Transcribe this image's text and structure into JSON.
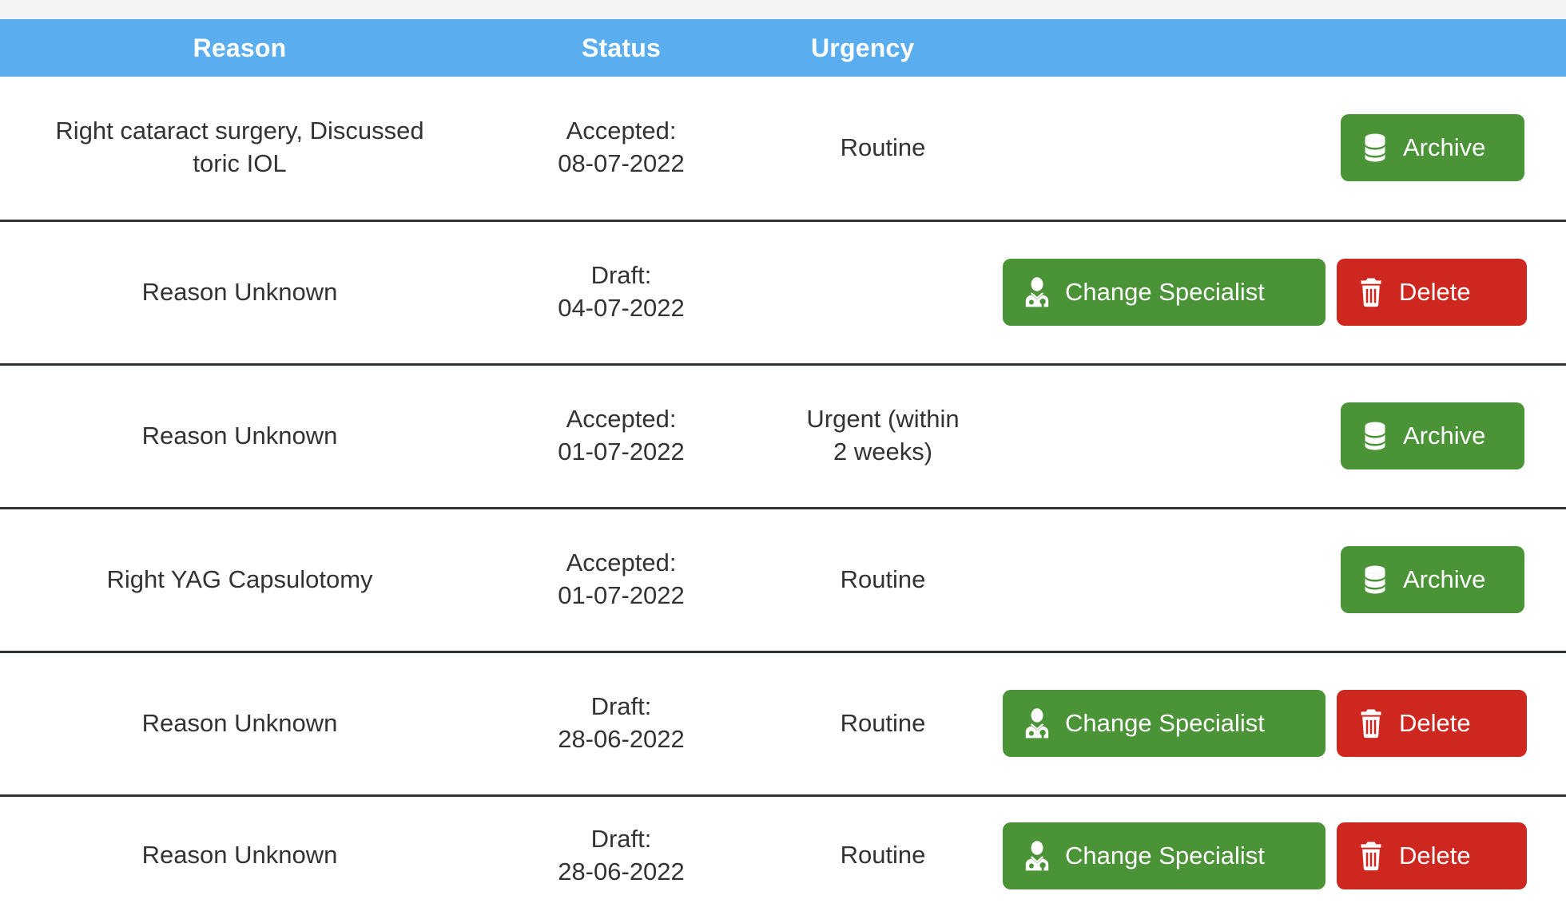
{
  "table": {
    "columns": [
      {
        "key": "reason",
        "label": "Reason"
      },
      {
        "key": "status",
        "label": "Status"
      },
      {
        "key": "urgency",
        "label": "Urgency"
      },
      {
        "key": "actions",
        "label": ""
      }
    ],
    "rows": [
      {
        "reason": "Right cataract surgery, Discussed toric IOL",
        "status": "Accepted:\n08-07-2022",
        "urgency": "Routine",
        "actions": [
          "archive"
        ]
      },
      {
        "reason": "Reason Unknown",
        "status": "Draft:\n04-07-2022",
        "urgency": "",
        "actions": [
          "change_specialist",
          "delete"
        ]
      },
      {
        "reason": "Reason Unknown",
        "status": "Accepted:\n01-07-2022",
        "urgency": "Urgent (within\n2 weeks)",
        "actions": [
          "archive"
        ]
      },
      {
        "reason": "Right YAG Capsulotomy",
        "status": "Accepted:\n01-07-2022",
        "urgency": "Routine",
        "actions": [
          "archive"
        ]
      },
      {
        "reason": "Reason Unknown",
        "status": "Draft:\n28-06-2022",
        "urgency": "Routine",
        "actions": [
          "change_specialist",
          "delete"
        ]
      },
      {
        "reason": "Reason Unknown",
        "status": "Draft:\n28-06-2022",
        "urgency": "Routine",
        "actions": [
          "change_specialist",
          "delete"
        ]
      }
    ]
  },
  "buttons": {
    "archive": {
      "label": "Archive",
      "icon": "database-icon",
      "color": "#4a9337"
    },
    "change_specialist": {
      "label": "Change Specialist",
      "icon": "user-doctor-icon",
      "color": "#4a9337"
    },
    "delete": {
      "label": "Delete",
      "icon": "trash-icon",
      "color": "#cd2720"
    }
  },
  "colors": {
    "header_background": "#5aaef0",
    "header_text": "#ffffff",
    "row_text": "#333333",
    "row_divider": "#2f3336",
    "top_strip": "#f2f4f6",
    "page_background": "#ffffff"
  }
}
